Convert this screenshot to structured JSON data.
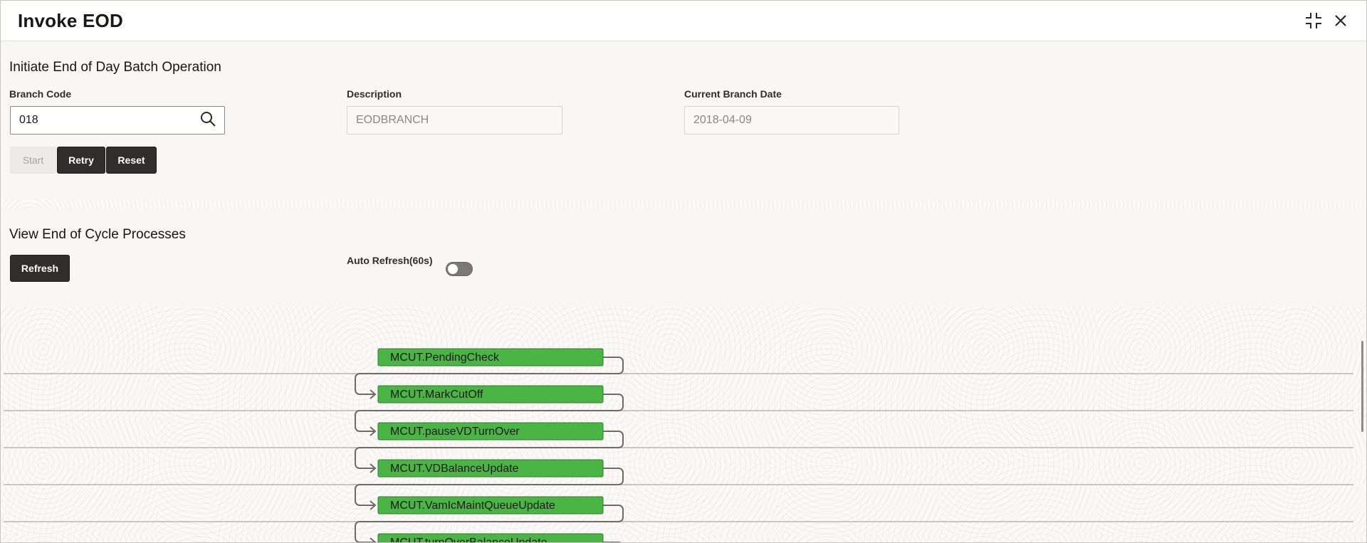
{
  "window": {
    "title": "Invoke EOD",
    "icons": {
      "minimize": "collapse-icon",
      "close": "close-icon"
    }
  },
  "initiate": {
    "heading": "Initiate End of Day Batch Operation",
    "branch_code": {
      "label": "Branch Code",
      "value": "018"
    },
    "description": {
      "label": "Description",
      "value": "EODBRANCH"
    },
    "current_branch_date": {
      "label": "Current Branch Date",
      "value": "2018-04-09"
    },
    "buttons": {
      "start": "Start",
      "retry": "Retry",
      "reset": "Reset"
    }
  },
  "view": {
    "heading": "View End of Cycle Processes",
    "refresh_label": "Refresh",
    "auto_refresh_label": "Auto Refresh(60s)",
    "auto_refresh_on": false
  },
  "flow": {
    "node_color": "#4ab545",
    "nodes": [
      {
        "label": "MCUT.PendingCheck"
      },
      {
        "label": "MCUT.MarkCutOff"
      },
      {
        "label": "MCUT.pauseVDTurnOver"
      },
      {
        "label": "MCUT.VDBalanceUpdate"
      },
      {
        "label": "MCUT.VamIcMaintQueueUpdate"
      },
      {
        "label": "MCUT.turnOverBalanceUpdate"
      }
    ]
  }
}
